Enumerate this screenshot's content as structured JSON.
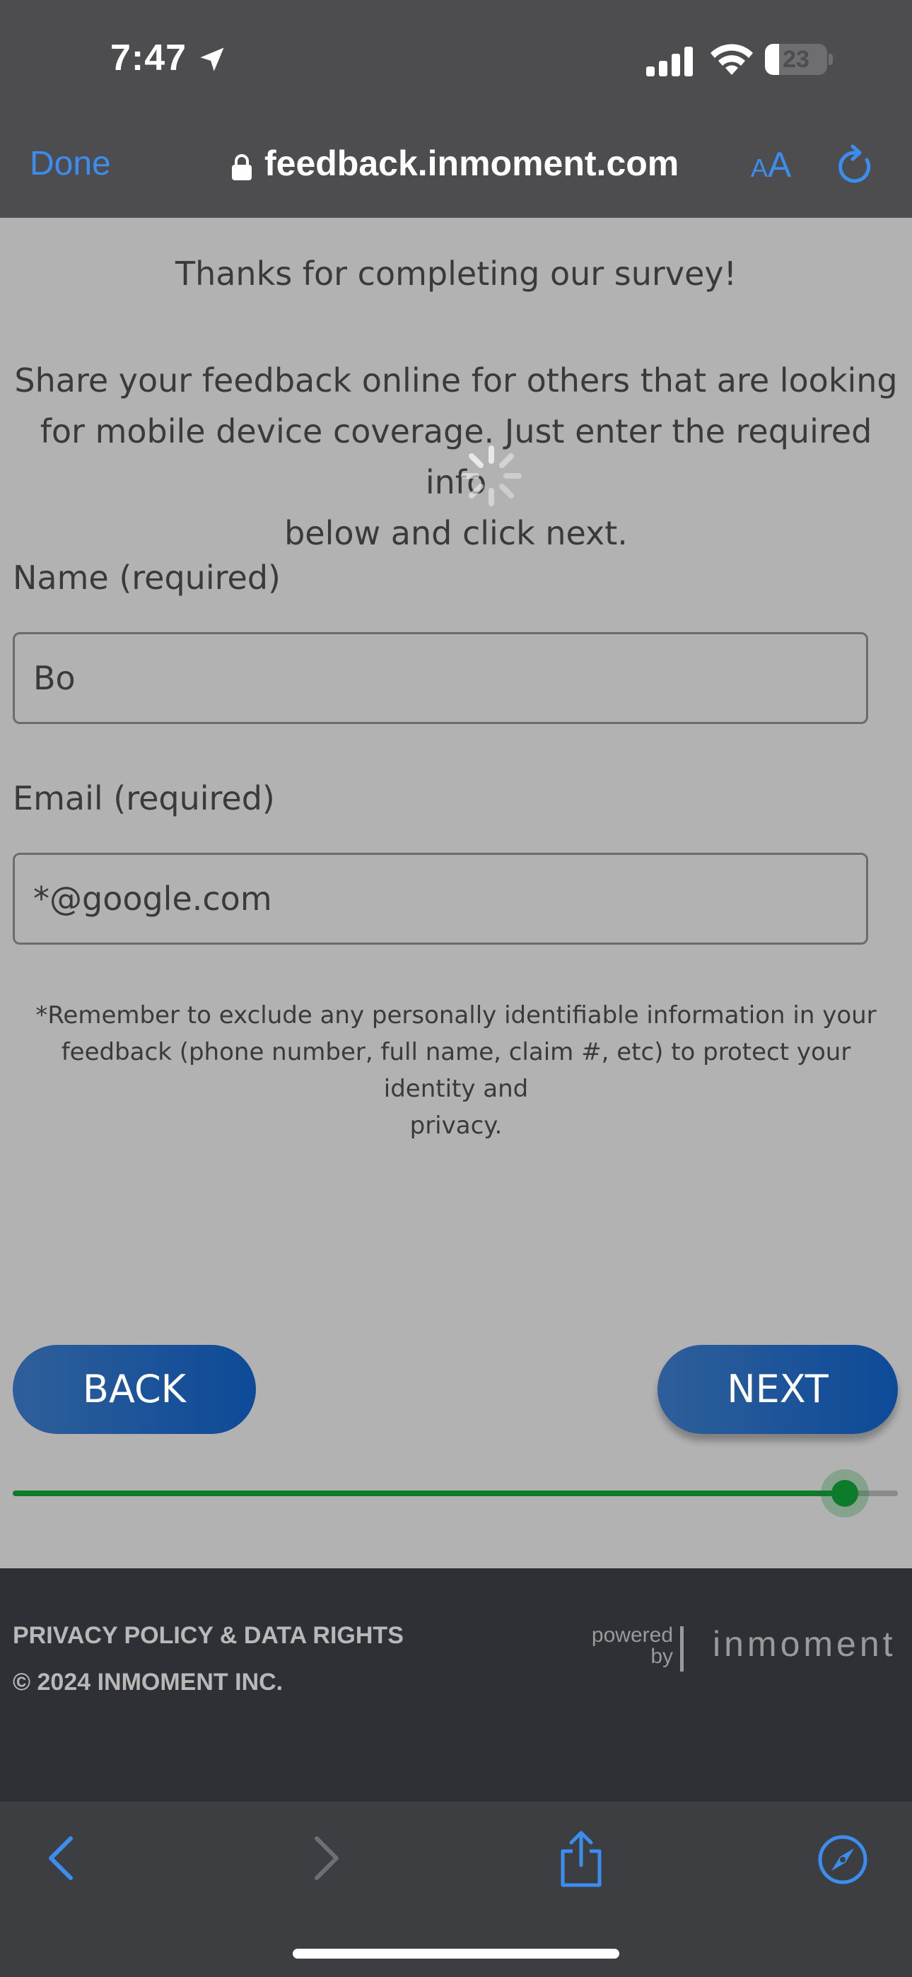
{
  "status_bar": {
    "time": "7:47",
    "battery": "23",
    "battery_level": 0.23,
    "icons": [
      "location-arrow-icon",
      "signal-icon",
      "wifi-icon",
      "battery-icon"
    ]
  },
  "url_bar": {
    "done_label": "Done",
    "url": "feedback.inmoment.com",
    "reader_label_small": "A",
    "reader_label_large": "A",
    "accent_color": "#3b8ef0"
  },
  "survey": {
    "thanks": "Thanks for completing our survey!",
    "share_line1": "Share your feedback online for others that are looking",
    "share_line2": "for mobile device coverage. Just enter the required info",
    "share_line3": "below and click next.",
    "name_label": "Name (required)",
    "name_value": "Bo",
    "email_label": "Email (required)",
    "email_value": "*@google.com",
    "disclaimer_line1": "*Remember to exclude any personally identifiable information in your",
    "disclaimer_line2": "feedback (phone number, full name, claim #, etc) to protect your identity and",
    "disclaimer_line3": "privacy.",
    "back_label": "BACK",
    "next_label": "NEXT",
    "progress": 0.94,
    "progress_color": "#0e7b2b",
    "button_color": "#0d4a98"
  },
  "footer": {
    "privacy": "PRIVACY POLICY & DATA RIGHTS",
    "copyright": "© 2024 INMOMENT INC.",
    "powered_line1": "powered",
    "powered_line2": "by",
    "brand": "inmoment"
  },
  "toolbar": {
    "icons": [
      "back-arrow-icon",
      "forward-arrow-icon",
      "share-icon",
      "compass-icon"
    ]
  }
}
